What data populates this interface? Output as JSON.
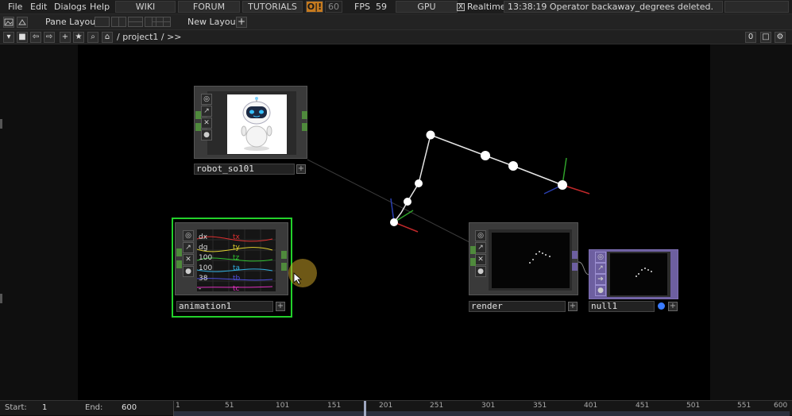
{
  "menu": {
    "file": "File",
    "edit": "Edit",
    "dialogs": "Dialogs",
    "help": "Help"
  },
  "topbar": {
    "wiki": "WIKI",
    "forum": "FORUM",
    "tutorials": "TUTORIALS",
    "ok": "O|!",
    "fps_target": "60",
    "fps_label": "FPS",
    "fps_value": "59",
    "gpu": "GPU",
    "realtime_check": "X",
    "realtime": "Realtime",
    "status": "13:38:19 Operator backaway_degrees deleted."
  },
  "panebar": {
    "pane_layout": "Pane Layout",
    "new_layout": "New Layout",
    "plus": "+"
  },
  "pathbar": {
    "path": "/ project1 / >>",
    "counter": "0"
  },
  "nodes": {
    "robot": {
      "name": "robot_so101"
    },
    "animation": {
      "name": "animation1",
      "channels": [
        {
          "l": "dx",
          "r": "tx"
        },
        {
          "l": "dg",
          "r": "ty"
        },
        {
          "l": "100",
          "r": "tz"
        },
        {
          "l": "100",
          "r": "ta"
        },
        {
          "l": "38",
          "r": "tb"
        },
        {
          "l": "-",
          "r": "tc"
        }
      ]
    },
    "render": {
      "name": "render"
    },
    "null": {
      "name": "null1"
    }
  },
  "timeline": {
    "start_label": "Start:",
    "start_value": "1",
    "end_label": "End:",
    "end_value": "600",
    "ticks": [
      "1",
      "51",
      "101",
      "151",
      "201",
      "251",
      "301",
      "351",
      "401",
      "451",
      "501",
      "551",
      "600"
    ]
  },
  "colors": {
    "selected": "#23d12b",
    "accent": "#c67a1e",
    "flag_blue": "#3a7bff"
  }
}
